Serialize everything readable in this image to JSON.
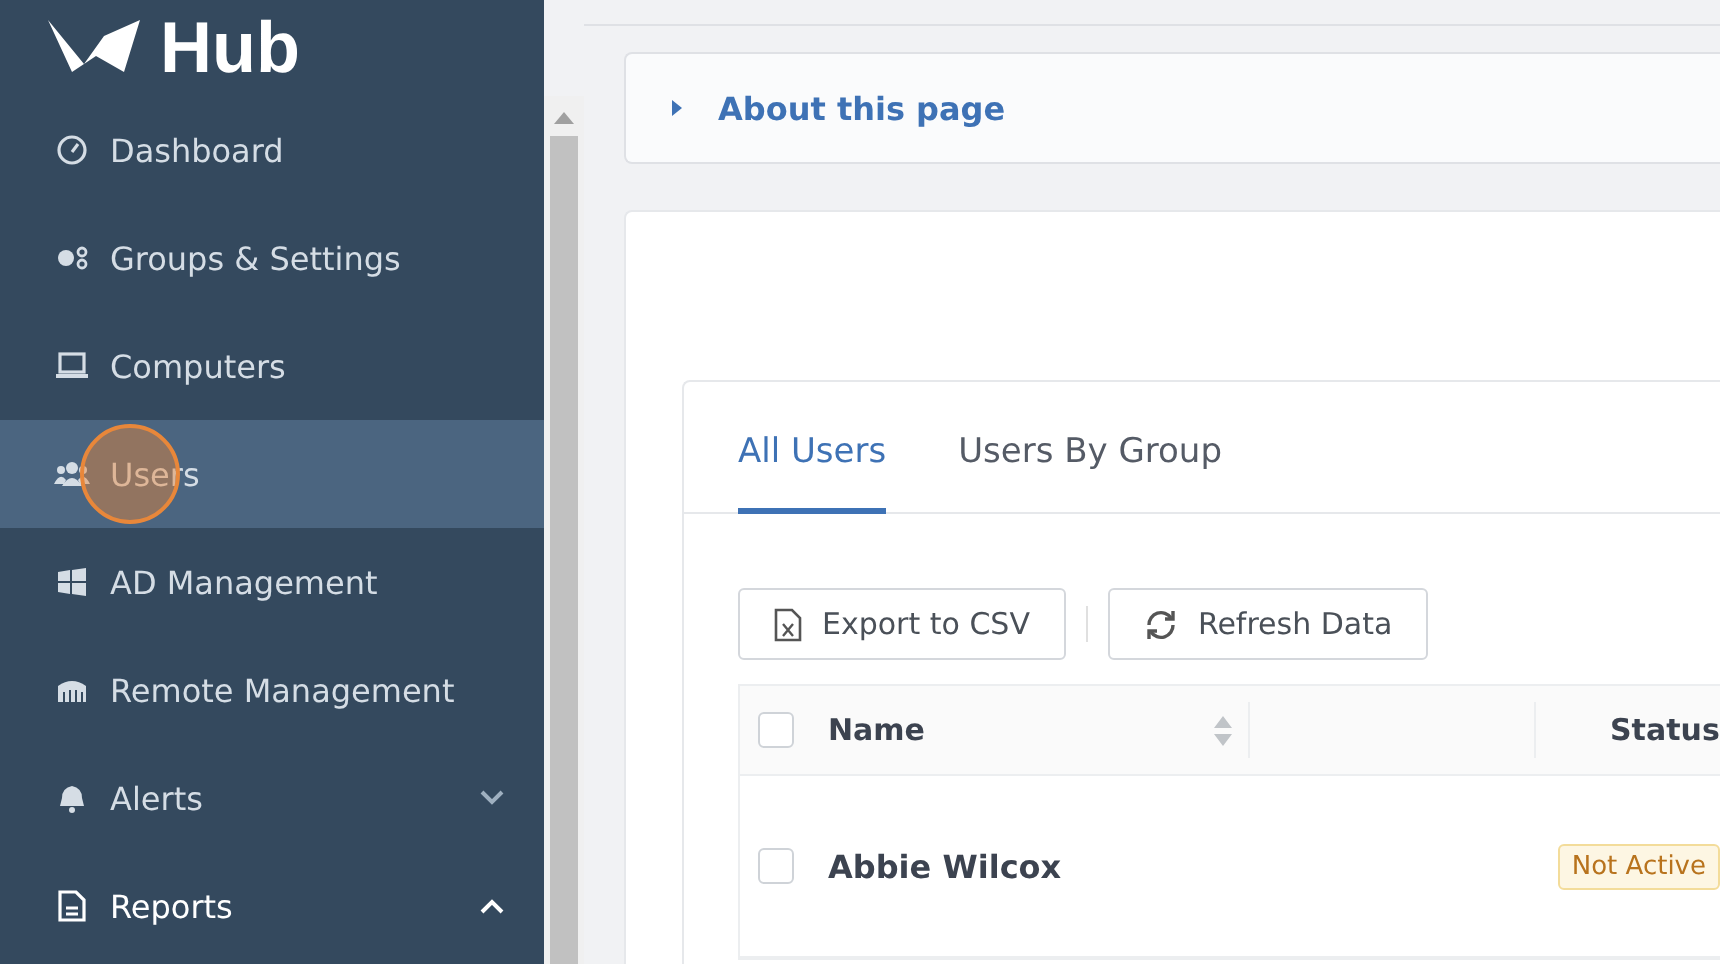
{
  "logo_text": "Hub",
  "sidebar": {
    "items": [
      {
        "label": "Dashboard",
        "selected": false
      },
      {
        "label": "Groups & Settings",
        "selected": false
      },
      {
        "label": "Computers",
        "selected": false
      },
      {
        "label": "Users",
        "selected": true
      },
      {
        "label": "AD Management",
        "selected": false
      },
      {
        "label": "Remote Management",
        "selected": false
      },
      {
        "label": "Alerts",
        "selected": false,
        "expanded": false
      },
      {
        "label": "Reports",
        "selected": false,
        "expanded": true
      }
    ]
  },
  "about_panel": {
    "title": "About this page",
    "expanded": false
  },
  "tabs": [
    {
      "label": "All Users",
      "selected": true
    },
    {
      "label": "Users By Group",
      "selected": false
    }
  ],
  "toolbar": [
    "Export to CSV",
    "Refresh Data"
  ],
  "table": {
    "columns": [
      "Name",
      "Status"
    ],
    "select_all_checked": false,
    "rows": [
      {
        "name": "Abbie Wilcox",
        "checked": false,
        "status": "Not Active"
      }
    ]
  }
}
